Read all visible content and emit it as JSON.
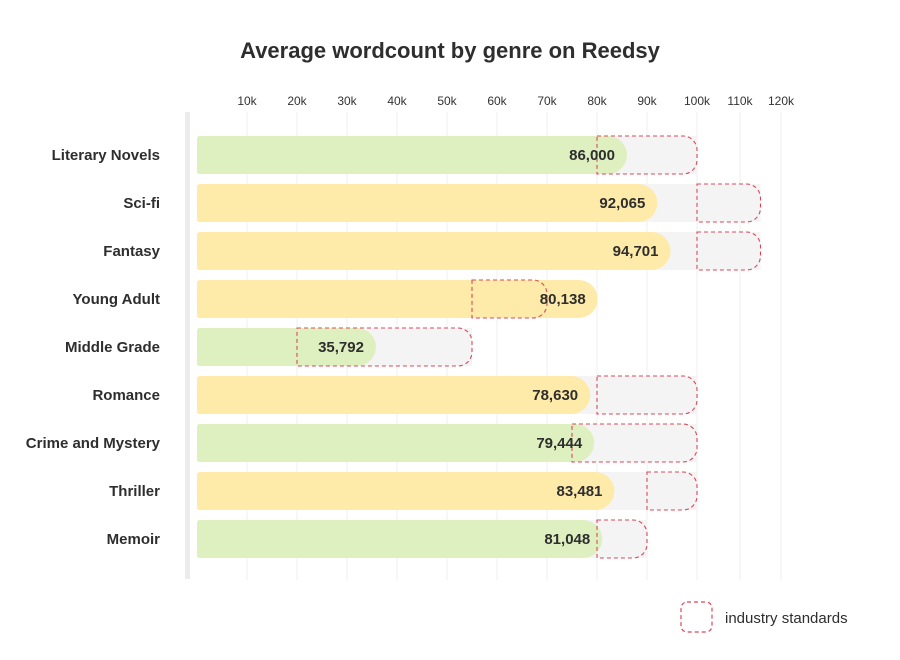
{
  "chart_data": {
    "type": "bar",
    "orientation": "horizontal",
    "title": "Average wordcount by genre on Reedsy",
    "xlabel": "",
    "ylabel": "",
    "x_ticks": [
      {
        "value": 10000,
        "label": "10k"
      },
      {
        "value": 20000,
        "label": "20k"
      },
      {
        "value": 30000,
        "label": "30k"
      },
      {
        "value": 40000,
        "label": "40k"
      },
      {
        "value": 50000,
        "label": "50k"
      },
      {
        "value": 60000,
        "label": "60k"
      },
      {
        "value": 70000,
        "label": "70k"
      },
      {
        "value": 80000,
        "label": "80k"
      },
      {
        "value": 90000,
        "label": "90k"
      },
      {
        "value": 100000,
        "label": "100k"
      },
      {
        "value": 110000,
        "label": "110k"
      },
      {
        "value": 120000,
        "label": "120k"
      }
    ],
    "xlim": [
      0,
      120000
    ],
    "grid": true,
    "categories": [
      "Literary Novels",
      "Sci-fi",
      "Fantasy",
      "Young Adult",
      "Middle Grade",
      "Romance",
      "Crime and Mystery",
      "Thriller",
      "Memoir"
    ],
    "series": [
      {
        "name": "Average wordcount",
        "values": [
          86000,
          92065,
          94701,
          80138,
          35792,
          78630,
          79444,
          83481,
          81048
        ],
        "labels": [
          "86,000",
          "92,065",
          "94,701",
          "80,138",
          "35,792",
          "78,630",
          "79,444",
          "83,481",
          "81,048"
        ],
        "within_standard": [
          true,
          false,
          false,
          false,
          true,
          false,
          true,
          false,
          true
        ]
      },
      {
        "name": "industry standards",
        "ranges": [
          [
            80000,
            100000
          ],
          [
            100000,
            115000
          ],
          [
            100000,
            115000
          ],
          [
            55000,
            70000
          ],
          [
            20000,
            55000
          ],
          [
            80000,
            100000
          ],
          [
            75000,
            100000
          ],
          [
            90000,
            100000
          ],
          [
            80000,
            90000
          ]
        ]
      }
    ],
    "legend": {
      "position": "bottom-right",
      "label": "industry standards"
    },
    "colors": {
      "within": "#def0c0",
      "outside": "#feeaa9",
      "track": "#f4f4f4",
      "standard_border": "#d9485a",
      "grid": "#efefef",
      "axis": "#ececec"
    }
  }
}
